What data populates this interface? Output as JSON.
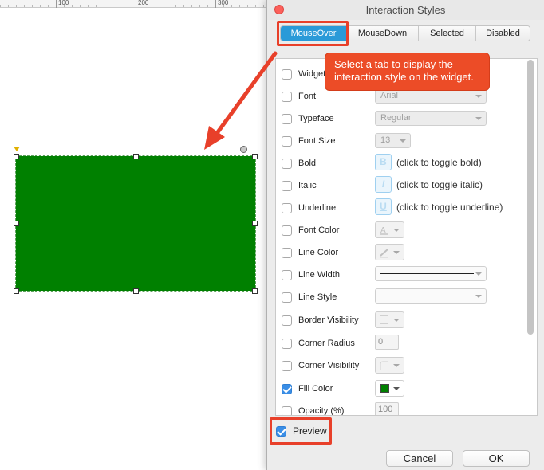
{
  "ruler": {
    "labels": [
      "100",
      "200",
      "300"
    ]
  },
  "dialog": {
    "title": "Interaction Styles",
    "tabs": [
      {
        "label": "MouseOver",
        "active": true
      },
      {
        "label": "MouseDown",
        "active": false
      },
      {
        "label": "Selected",
        "active": false
      },
      {
        "label": "Disabled",
        "active": false
      }
    ],
    "callout_text_line1": "Select a tab to display the",
    "callout_text_line2": "interaction style on the widget.",
    "properties": [
      {
        "label": "Widget",
        "checked": false
      },
      {
        "label": "Font",
        "checked": false,
        "value": "Arial"
      },
      {
        "label": "Typeface",
        "checked": false,
        "value": "Regular"
      },
      {
        "label": "Font Size",
        "checked": false,
        "value": "13"
      },
      {
        "label": "Bold",
        "checked": false,
        "button": "B",
        "hint": "(click to toggle bold)"
      },
      {
        "label": "Italic",
        "checked": false,
        "button": "I",
        "hint": "(click to toggle italic)"
      },
      {
        "label": "Underline",
        "checked": false,
        "button": "U",
        "hint": "(click to toggle underline)"
      },
      {
        "label": "Font Color",
        "checked": false
      },
      {
        "label": "Line Color",
        "checked": false
      },
      {
        "label": "Line Width",
        "checked": false
      },
      {
        "label": "Line Style",
        "checked": false
      },
      {
        "label": "Border Visibility",
        "checked": false
      },
      {
        "label": "Corner Radius",
        "checked": false,
        "value": "0"
      },
      {
        "label": "Corner Visibility",
        "checked": false
      },
      {
        "label": "Fill Color",
        "checked": true,
        "color": "#008000"
      },
      {
        "label": "Opacity (%)",
        "checked": false,
        "value": "100"
      }
    ],
    "preview": {
      "label": "Preview",
      "checked": true
    },
    "cancel_label": "Cancel",
    "ok_label": "OK"
  },
  "colors": {
    "accent": "#2a9ad8",
    "annotation": "#e8402a",
    "widget_fill": "#008000"
  }
}
